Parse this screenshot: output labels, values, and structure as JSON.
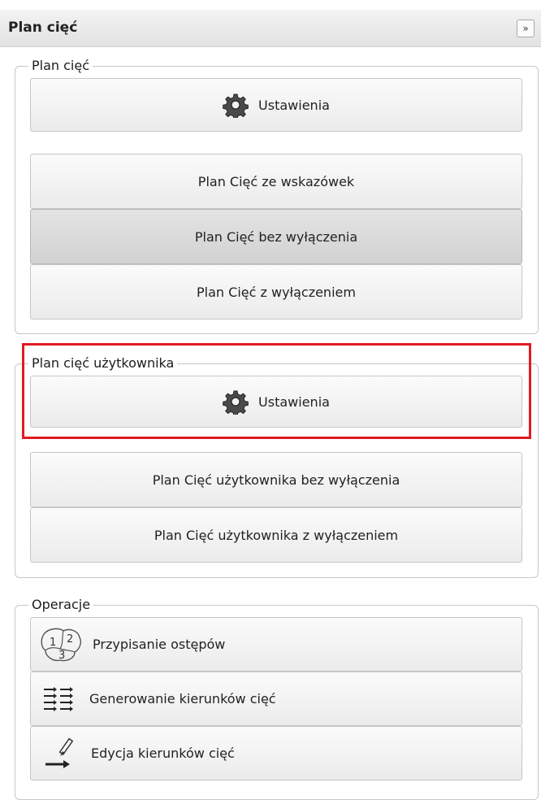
{
  "header": {
    "title": "Plan cięć",
    "collapse_label": "»"
  },
  "plan_ciec": {
    "legend": "Plan cięć",
    "settings_label": "Ustawienia",
    "buttons": [
      {
        "label": "Plan Cięć ze wskazówek"
      },
      {
        "label": "Plan Cięć bez wyłączenia"
      },
      {
        "label": "Plan Cięć z wyłączeniem"
      }
    ]
  },
  "plan_uzytkownika": {
    "legend": "Plan cięć użytkownika",
    "settings_label": "Ustawienia",
    "buttons": [
      {
        "label": "Plan Cięć użytkownika bez wyłączenia"
      },
      {
        "label": "Plan Cięć użytkownika z wyłączeniem"
      }
    ]
  },
  "operacje": {
    "legend": "Operacje",
    "buttons": [
      {
        "label": "Przypisanie ostępów",
        "icon": "numbered-regions-icon"
      },
      {
        "label": "Generowanie kierunków cięć",
        "icon": "direction-arrows-icon"
      },
      {
        "label": "Edycja kierunków cięć",
        "icon": "edit-direction-icon"
      }
    ]
  },
  "colors": {
    "highlight": "#e11a22",
    "pressed": "#d9d9d9"
  }
}
